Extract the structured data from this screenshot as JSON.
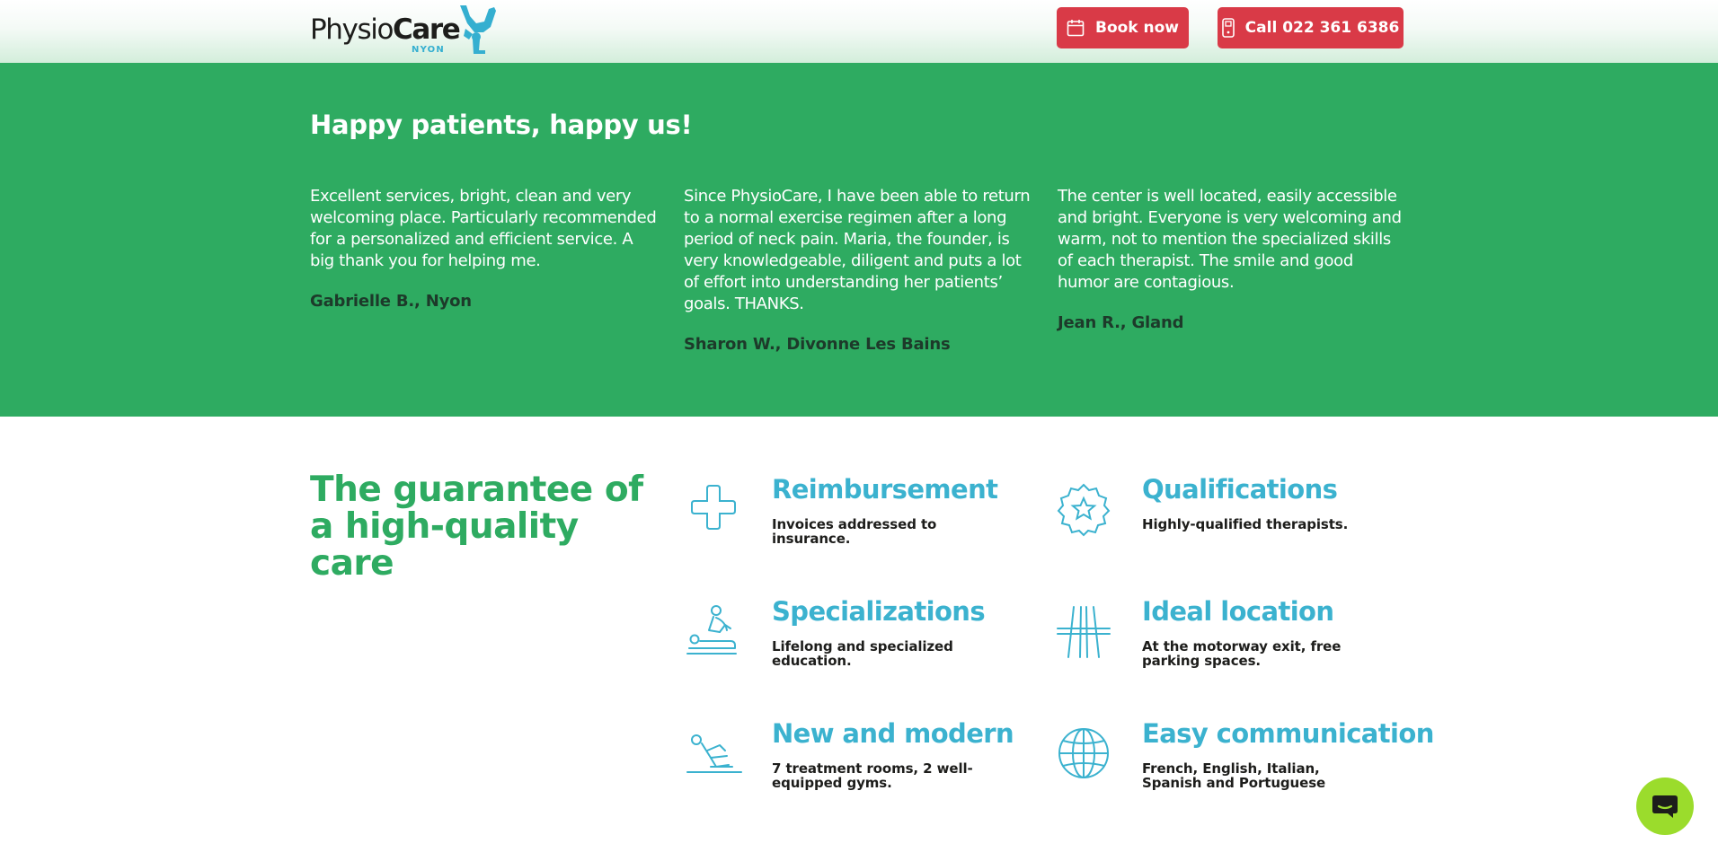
{
  "header": {
    "logo": {
      "name_light": "Physio",
      "name_bold": "Care",
      "location": "NYON"
    },
    "book_label": "Book now",
    "call_label": "Call 022 361 6386"
  },
  "testimonials": {
    "title": "Happy patients, happy us!",
    "items": [
      {
        "text": "Excellent services, bright, clean and very welcoming place. Particularly recommended for a personalized and efficient service. A big thank you for helping me.",
        "author": "Gabrielle B., Nyon"
      },
      {
        "text": "Since PhysioCare, I have been able to return to a normal exercise regimen after a long period of neck pain. Maria, the founder, is very knowledgeable, diligent and puts a lot of effort into understanding her patients’ goals. THANKS.",
        "author": "Sharon W., Divonne Les Bains"
      },
      {
        "text": "The center is well located, easily accessible and bright. Everyone is very welcoming and warm, not to mention the specialized skills of each therapist. The smile and good humor are contagious.",
        "author": "Jean R., Gland"
      }
    ]
  },
  "guarantee": {
    "title": "The guarantee of a high-quality care",
    "features": [
      {
        "title": "Reimbursement",
        "text": "Invoices addressed to insurance.",
        "icon": "medical-cross-icon"
      },
      {
        "title": "Qualifications",
        "text": "Highly-qualified therapists.",
        "icon": "star-badge-icon"
      },
      {
        "title": "Specializations",
        "text": "Lifelong and specialized education.",
        "icon": "massage-therapy-icon"
      },
      {
        "title": "Ideal location",
        "text": "At the motorway exit, free parking spaces.",
        "icon": "motorway-icon"
      },
      {
        "title": "New and modern",
        "text": "7 treatment rooms, 2 well-equipped gyms.",
        "icon": "exercise-person-icon"
      },
      {
        "title": "Easy communication",
        "text": "French, English, Italian, Spanish and Portuguese",
        "icon": "globe-icon"
      }
    ]
  },
  "colors": {
    "green": "#2eab61",
    "red": "#d93a47",
    "teal": "#3bb2cf",
    "chat": "#9bdc2c"
  }
}
